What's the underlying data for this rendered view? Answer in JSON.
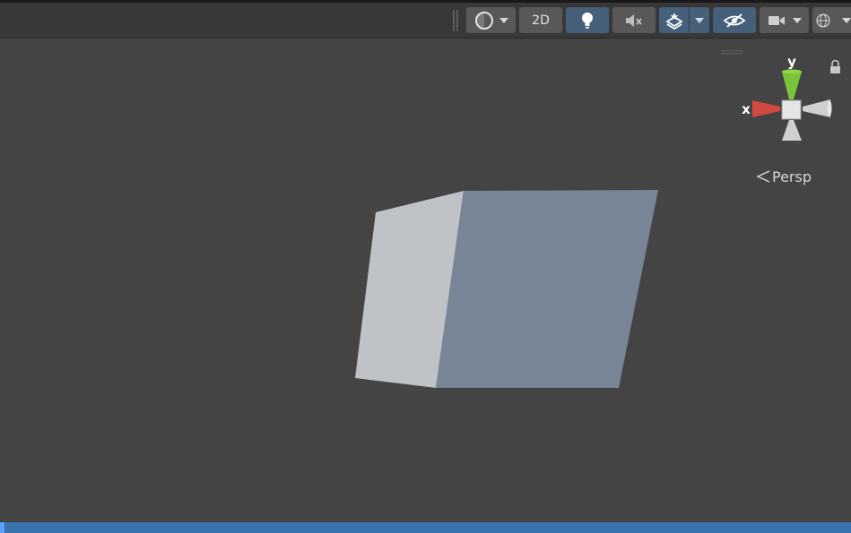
{
  "toolbar": {
    "buttons": [
      {
        "name": "draw-mode",
        "icon": "shading-mode-icon",
        "has_dropdown": true
      },
      {
        "name": "2d",
        "label": "2D"
      },
      {
        "name": "lighting",
        "icon": "light-bulb-icon",
        "active": true
      },
      {
        "name": "audio",
        "icon": "audio-mute-icon"
      },
      {
        "name": "effects",
        "icon": "layers-icon",
        "active": true,
        "has_dropdown": true
      },
      {
        "name": "scene-visibility",
        "icon": "hidden-eye-icon",
        "active": true
      },
      {
        "name": "camera",
        "icon": "camera-icon",
        "has_dropdown": true
      },
      {
        "name": "gizmos",
        "icon": "globe-icon",
        "has_dropdown": true
      }
    ]
  },
  "scene_gizmo": {
    "axis_y": "y",
    "axis_x": "x",
    "projection": "Persp",
    "locked": true
  },
  "colors": {
    "viewport_bg": "#444444",
    "toolbar_bg": "#383838",
    "active_button": "#46607c",
    "cube_light_face": "#bfc3c8",
    "cube_dark_face": "#788596",
    "axis_x": "#d2493f",
    "axis_y": "#7ac43a",
    "status_bar": "#3a72b0"
  }
}
